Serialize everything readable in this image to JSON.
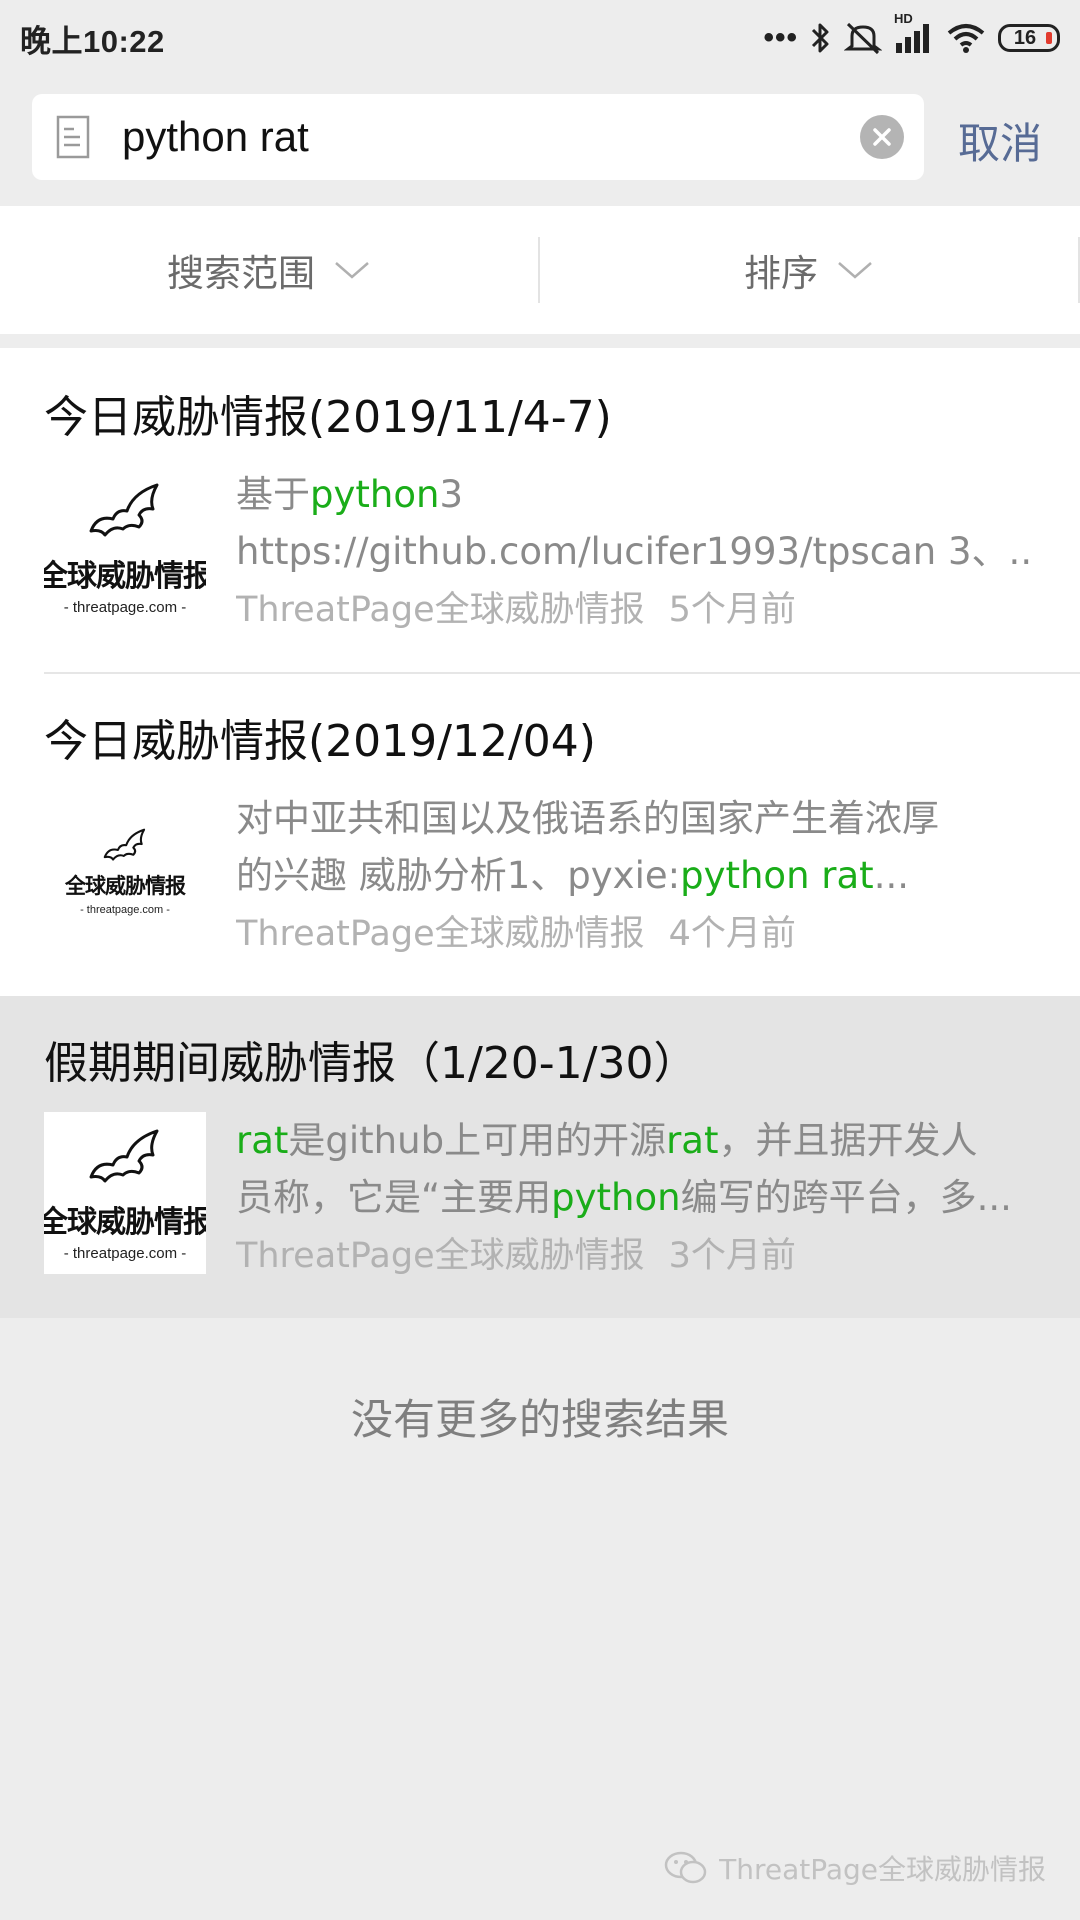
{
  "status_bar": {
    "time": "晚上10:22",
    "network_label": "HD",
    "battery_level": "16",
    "icons": [
      "more-dots-icon",
      "bluetooth-icon",
      "mute-icon",
      "signal-icon",
      "wifi-icon",
      "battery-icon"
    ]
  },
  "search": {
    "query": "python rat",
    "placeholder": "",
    "cancel_label": "取消"
  },
  "filters": {
    "scope_label": "搜索范围",
    "sort_label": "排序"
  },
  "results": [
    {
      "title": "今日威胁情报(2019/11/4-7)",
      "thumbnail_title": "全球威胁情报",
      "thumbnail_url": "- threatpage.com -",
      "snippet_lines": [
        [
          {
            "text": "基于"
          },
          {
            "text": "python",
            "hl": true
          },
          {
            "text": "3"
          }
        ],
        [
          {
            "text": "https://github.com/lucifer1993/tpscan 3、..."
          }
        ]
      ],
      "source": "ThreatPage全球威胁情报",
      "time": "5个月前"
    },
    {
      "title": "今日威胁情报(2019/12/04)",
      "thumbnail_title": "全球威胁情报",
      "thumbnail_url": "- threatpage.com -",
      "snippet_lines": [
        [
          {
            "text": "对中亚共和国以及俄语系的国家产生着浓厚"
          }
        ],
        [
          {
            "text": "的兴趣 威胁分析1、pyxie:"
          },
          {
            "text": "python rat",
            "hl": true
          },
          {
            "text": "..."
          }
        ]
      ],
      "source": "ThreatPage全球威胁情报",
      "time": "4个月前"
    },
    {
      "title": "假期期间威胁情报（1/20-1/30）",
      "thumbnail_title": "全球威胁情报",
      "thumbnail_url": "- threatpage.com -",
      "snippet_lines": [
        [
          {
            "text": "rat",
            "hl": true
          },
          {
            "text": "是github上可用的开源"
          },
          {
            "text": "rat",
            "hl": true
          },
          {
            "text": "，并且据开发人"
          }
        ],
        [
          {
            "text": "员称，它是“主要用"
          },
          {
            "text": "python",
            "hl": true
          },
          {
            "text": "编写的跨平台，多..."
          }
        ]
      ],
      "source": "ThreatPage全球威胁情报",
      "time": "3个月前"
    }
  ],
  "no_more_text": "没有更多的搜索结果",
  "watermark": "ThreatPage全球威胁情报",
  "colors": {
    "highlight": "#1aad19",
    "cancel": "#576b95",
    "background": "#ededed"
  }
}
